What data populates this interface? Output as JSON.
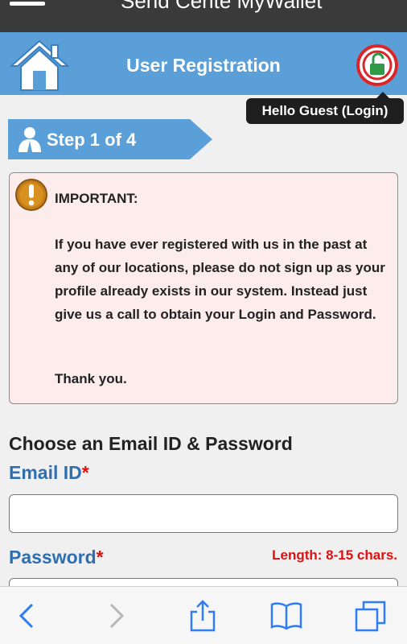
{
  "browser": {
    "page_title": "Send Cente MyWallet",
    "menu_icon": "hamburger-menu-icon"
  },
  "header": {
    "title": "User Registration",
    "home_icon": "home-icon",
    "login_icon": "unlock-icon",
    "tooltip": "Hello Guest (Login)",
    "background_color": "#5a9fd8"
  },
  "step": {
    "label": "Step 1 of 4",
    "icon": "user-icon",
    "color": "#5a9fd8"
  },
  "notice": {
    "icon": "exclamation-icon",
    "title": "IMPORTANT:",
    "body": "If you have ever registered with us in the past at any of our locations, please do not sign up as your profile already exists in our system. Instead just give us a call to obtain your Login and Password.",
    "closing": "Thank you.",
    "background_color": "#fdecec"
  },
  "form": {
    "section_heading": "Choose an Email ID & Password",
    "email_label": "Email ID",
    "password_label": "Password",
    "required_mark": "*",
    "email_value": "",
    "password_value": "",
    "password_hint": "Length: 8-15 chars.",
    "label_color": "#2f6fb0",
    "required_color": "#e01010"
  },
  "toolbar": {
    "icons": [
      "back-arrow-icon",
      "forward-arrow-icon",
      "share-icon",
      "bookmarks-icon",
      "tabs-icon"
    ]
  }
}
